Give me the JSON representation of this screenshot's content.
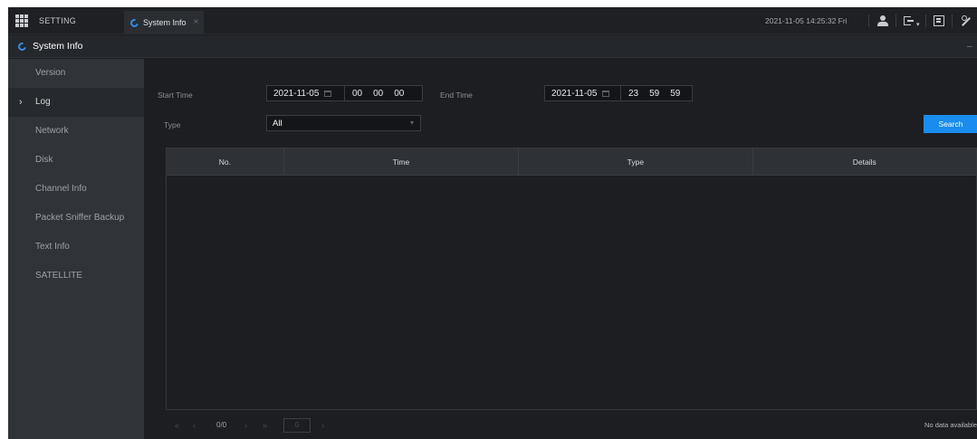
{
  "topbar": {
    "setting_label": "SETTING",
    "tab_label": "System Info",
    "tab_close": "×",
    "datetime": "2021-11-05 14:25:32 Fri"
  },
  "titlebar": {
    "title": "System Info",
    "minimize": "–"
  },
  "sidebar": {
    "items": [
      {
        "label": "Version"
      },
      {
        "label": "Log"
      },
      {
        "label": "Network"
      },
      {
        "label": "Disk"
      },
      {
        "label": "Channel Info"
      },
      {
        "label": "Packet Sniffer Backup"
      },
      {
        "label": "Text Info"
      },
      {
        "label": "SATELLITE"
      }
    ],
    "active_caret": "›"
  },
  "filters": {
    "start_label": "Start Time",
    "start_date": "2021-11-05",
    "start_hh": "00",
    "start_mm": "00",
    "start_ss": "00",
    "end_label": "End Time",
    "end_date": "2021-11-05",
    "end_hh": "23",
    "end_mm": "59",
    "end_ss": "59",
    "type_label": "Type",
    "type_value": "All",
    "search_label": "Search"
  },
  "table": {
    "columns": [
      "No.",
      "Time",
      "Type",
      "Details"
    ],
    "rows": []
  },
  "pager": {
    "count": "0/0",
    "first": "«",
    "prev": "‹",
    "next": "›",
    "last": "»",
    "page_input": "0",
    "go": "›",
    "no_data": "No data available"
  }
}
